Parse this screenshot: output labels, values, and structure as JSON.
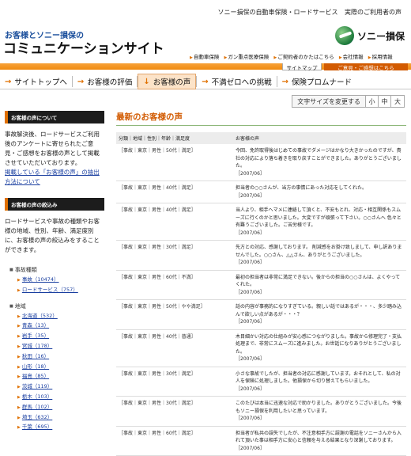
{
  "header": {
    "top_links": [
      "ソニー損保の自動車保険・ロードサービス",
      "実際のご利用者の声"
    ],
    "tagline": "お客様とソニー損保の",
    "title": "コミュニケーションサイト",
    "logo_text": "ソニー損保",
    "sub_links": [
      "自動車保険",
      "ガン重点医療保険",
      "ご契約者のかたはこちら",
      "会社情報",
      "採用情報"
    ],
    "sitemap": "サイトマップ",
    "opinion_tab": "ご意見・ご感想はこちら"
  },
  "nav": {
    "items": [
      "サイトトップへ",
      "お客様の評価",
      "お客様の声",
      "不満ゼロへの挑戦",
      "保険プロムナード"
    ],
    "active_index": 2
  },
  "font_size": {
    "label": "文字サイズを変更する",
    "small": "小",
    "medium": "中",
    "large": "大"
  },
  "sidebar": {
    "about_head": "お客様の声について",
    "about_text": "事故解決後、ロードサービスご利用後のアンケートに寄せられたご意見・ご感想をお客様の声として掲載させていただいております。",
    "about_link": "掲載している「お客様の声」の抽出方法について",
    "filter_head": "お客様の声の絞込み",
    "filter_text": "ロードサービスや事故の種類やお客様の地域、性別、年齢、満足度別に、お客様の声の絞込みをすることができます。",
    "type_label": "事故種類",
    "types": [
      "事故（10474）",
      "ロードサービス（757）"
    ],
    "region_label": "地域",
    "regions": [
      "北海道（532）",
      "青森（13）",
      "岩手（35）",
      "宮城（178）",
      "秋田（16）",
      "山形（18）",
      "福島（85）",
      "茨城（119）",
      "栃木（103）",
      "群馬（102）",
      "埼玉（632）",
      "千葉（695）"
    ]
  },
  "content": {
    "title": "最新のお客様の声",
    "columns": [
      "分類｜地域｜性別｜年齢｜満足度",
      "お客様の声"
    ],
    "rows": [
      {
        "cat": "［事故｜東京｜男性｜50代｜満足］",
        "text": "今回、免許取得後はじめての事故でダメージはかなり大きかったのですが、貴社の対応により落ち着きを取り戻すことができました。ありがとうございました。",
        "date": "［2007/06］"
      },
      {
        "cat": "［事故｜東京｜男性｜40代｜満足］",
        "text": "担当者の○○さんが、当方の事情にあった対応をしてくれた。",
        "date": "［2007/06］"
      },
      {
        "cat": "［事故｜東京｜男性｜40代｜満足］",
        "text": "当人より、相手へマメに連絡して頂くと、不安もとれ、対応・相互関係もスムーズに行くのかと思いました。大変ですが頑張って下さい。○○さんへ 色々と有難うございました。ご苦労様です。",
        "date": "［2007/06］"
      },
      {
        "cat": "［事故｜東京｜男性｜30代｜満足］",
        "text": "先方との対応、感謝しております。 削減感をお掛け致しまして、申し訳ありませんでした。○○さん、△△さん、ありがとうございました。",
        "date": "［2007/06］"
      },
      {
        "cat": "［事故｜東京｜男性｜60代｜不満］",
        "text": "最初の担当者は非常に満足できない。後からの担当の○○さんは、よくやってくれた。",
        "date": "［2007/06］"
      },
      {
        "cat": "［事故｜東京｜男性｜50代｜やや満足］",
        "text": "話の内容が事務的になりすぎている。親しい話ではあるが・・・、多少踏み込んで欲しい点があるが・・・？",
        "date": "［2007/06］"
      },
      {
        "cat": "［事故｜東京｜男性｜40代｜普通］",
        "text": "木目細かい対応の仕組みが安心感につながりました。事故から修理完了・支払処理まで、非常にスムーズに進みました。お世話になりありがとうございました。",
        "date": "［2007/06］"
      },
      {
        "cat": "［事故｜東京｜男性｜30代｜満足］",
        "text": "小さな事故でしたが、担当者の対応に感謝しています。おそれとして、私の対人を保険に処理しました。他損保から切り替えてもらいました。",
        "date": "［2007/06］"
      },
      {
        "cat": "［事故｜東京｜男性｜30代｜満足］",
        "text": "このたびは本当に迅速な対応で助かりました。ありがとうございました。今後もソニー損保を利用したいと思っています。",
        "date": "［2007/06］"
      },
      {
        "cat": "［事故｜東京｜男性｜60代｜満足］",
        "text": "担当者が私共の誤失でしたが、不注意相手方に誤謝の電話をソニーさんから入れて頂いた事は相手方に安心と信頼を与える結果となり深謝しております。",
        "date": "［2007/06］"
      }
    ]
  }
}
